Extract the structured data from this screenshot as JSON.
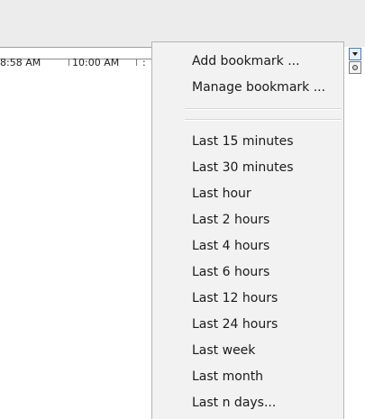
{
  "timeline": {
    "ticks": [
      "8:58 AM",
      "10:00 AM",
      ":"
    ]
  },
  "menu": {
    "bookmark_items": [
      "Add bookmark ...",
      "Manage bookmark ..."
    ],
    "range_items": [
      "Last 15 minutes",
      "Last 30 minutes",
      "Last hour",
      "Last 2 hours",
      "Last 4 hours",
      "Last 6 hours",
      "Last 12 hours",
      "Last 24 hours",
      "Last week",
      "Last month",
      "Last n days..."
    ]
  },
  "controls": {
    "dropdown_icon": "chevron-down-icon",
    "radio_icon": "radio-icon"
  }
}
